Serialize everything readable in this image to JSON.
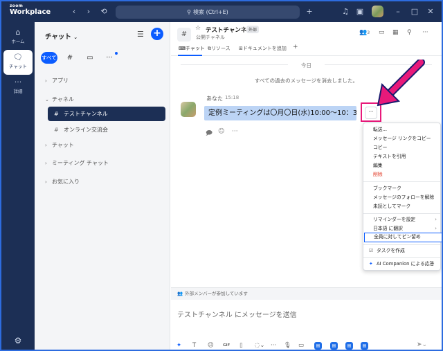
{
  "app": {
    "logo_line1": "zoom",
    "logo_line2": "Workplace",
    "search_placeholder": "検索 (Ctrl+E)",
    "nav_back_icon": "chevron-left-icon",
    "nav_forward_icon": "chevron-right-icon",
    "history_icon": "history-icon"
  },
  "rail": {
    "items": [
      {
        "label": "ホーム",
        "icon": "home-icon"
      },
      {
        "label": "チャット",
        "icon": "chat-icon"
      },
      {
        "label": "詳細",
        "icon": "more-icon"
      }
    ]
  },
  "panel": {
    "title": "チャット",
    "filter_all": "すべて",
    "sections": {
      "apps": "アプリ",
      "channels": "チャネル",
      "chat": "チャット",
      "meeting_chat": "ミーティング チャット",
      "favorites": "お気に入り"
    },
    "channels": [
      {
        "name": "テストチャンネル"
      },
      {
        "name": "オンライン交流会"
      }
    ]
  },
  "channel": {
    "name": "テストチャンネル",
    "badge": "外部",
    "subtitle": "公開チャネル",
    "member_count": "3",
    "tabs": [
      "チャット",
      "リソース",
      "ドキュメントを追加"
    ],
    "tab_add": "+"
  },
  "feed": {
    "day_label": "今日",
    "cleared_notice": "すべての過去のメッセージを消去しました。",
    "message": {
      "sender": "あなた",
      "time": "15:18",
      "text": "定例ミーティングは〇月〇日(水)10:00～10：30",
      "more_label": "···"
    }
  },
  "composer": {
    "external_note": "外部メンバーが参加しています",
    "placeholder": "テストチャンネル にメッセージを送信",
    "gif_label": "GIF"
  },
  "menu": {
    "group1": [
      "転送...",
      "メッセージ リンクをコピー",
      "コピー",
      "テキストを引用",
      "編集"
    ],
    "delete": "削除",
    "group2": [
      "ブックマーク",
      "メッセージのフォローを解除",
      "未読としてマーク"
    ],
    "reminder": "リマインダーを設定",
    "translate": "日本語 に翻訳",
    "pin": "全員に対してピン留め",
    "task": "タスクを作成",
    "ai": "AI Companion による応答"
  },
  "colors": {
    "brand_navy": "#1c2f55",
    "accent_blue": "#0b5cff",
    "highlight_pink": "#e8197a",
    "message_bubble": "#bcd4f5"
  }
}
